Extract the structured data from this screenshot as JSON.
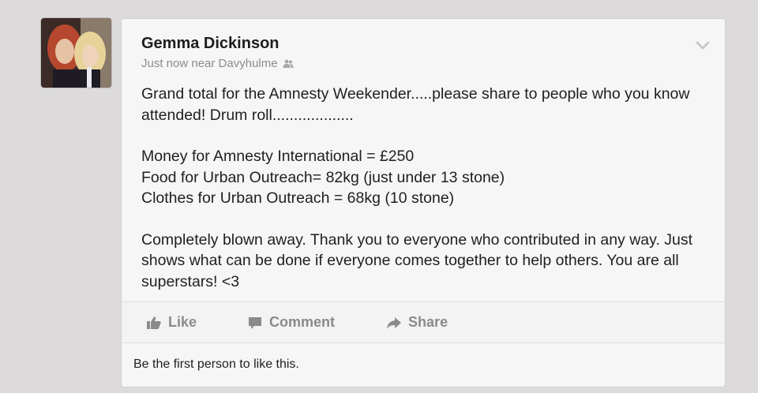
{
  "post": {
    "author": "Gemma Dickinson",
    "meta": "Just now near Davyhulme",
    "privacy_icon": "friends-icon",
    "paragraphs": [
      "Grand total for the Amnesty Weekender.....please share to people who you know attended! Drum roll...................",
      "Money for Amnesty International = £250",
      "Food for Urban Outreach= 82kg (just under 13 stone)",
      "Clothes for Urban Outreach = 68kg (10 stone)",
      "Completely blown away. Thank you to everyone who contributed in any way. Just shows what can be done if everyone comes together to help others. You are all superstars! <3"
    ]
  },
  "actions": {
    "like_label": "Like",
    "comment_label": "Comment",
    "share_label": "Share"
  },
  "likes_text": "Be the first person to like this."
}
